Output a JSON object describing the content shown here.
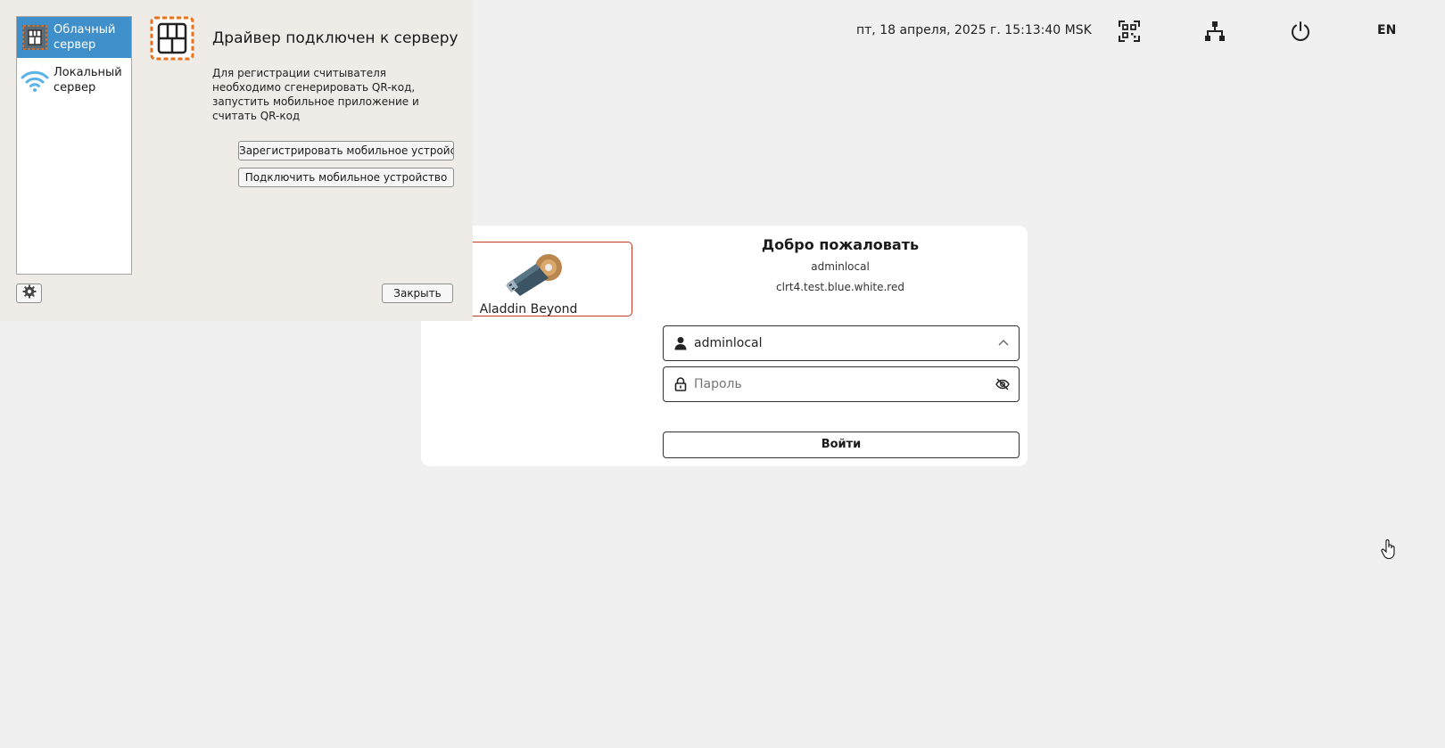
{
  "topbar": {
    "datetime": "пт, 18 апреля, 2025 г. 15:13:40 MSK",
    "qr_icon": "qr-scan-icon",
    "network_icon": "network-tree-icon",
    "power_icon": "power-icon",
    "language": "EN"
  },
  "login": {
    "token_name": "Aladdin Beyond",
    "token_warning_icon": "warning-icon",
    "welcome_title": "Добро пожаловать",
    "username_display": "adminlocal",
    "hostname": "clrt4.test.blue.white.red",
    "user_field_value": "adminlocal",
    "password_placeholder": "Пароль",
    "login_button": "Войти"
  },
  "driver_dialog": {
    "servers": [
      {
        "label": "Облачный сервер",
        "icon": "cloud-server-icon",
        "selected": true
      },
      {
        "label": "Локальный сервер",
        "icon": "wifi-icon",
        "selected": false
      }
    ],
    "title": "Драйвер подключен к серверу",
    "description": "Для регистрации считывателя необходимо сгенерировать QR-код, запустить мобильное приложение и считать QR-код",
    "register_button": "Зарегистрировать мобильное устройство",
    "connect_button": "Подключить мобильное устройство",
    "close_button": "Закрыть",
    "settings_icon": "gear-icon"
  },
  "colors": {
    "accent_orange": "#e8731f",
    "selection_blue": "#3e8fca",
    "warning_red": "#c0392b",
    "wifi_blue": "#5ab4e8"
  }
}
